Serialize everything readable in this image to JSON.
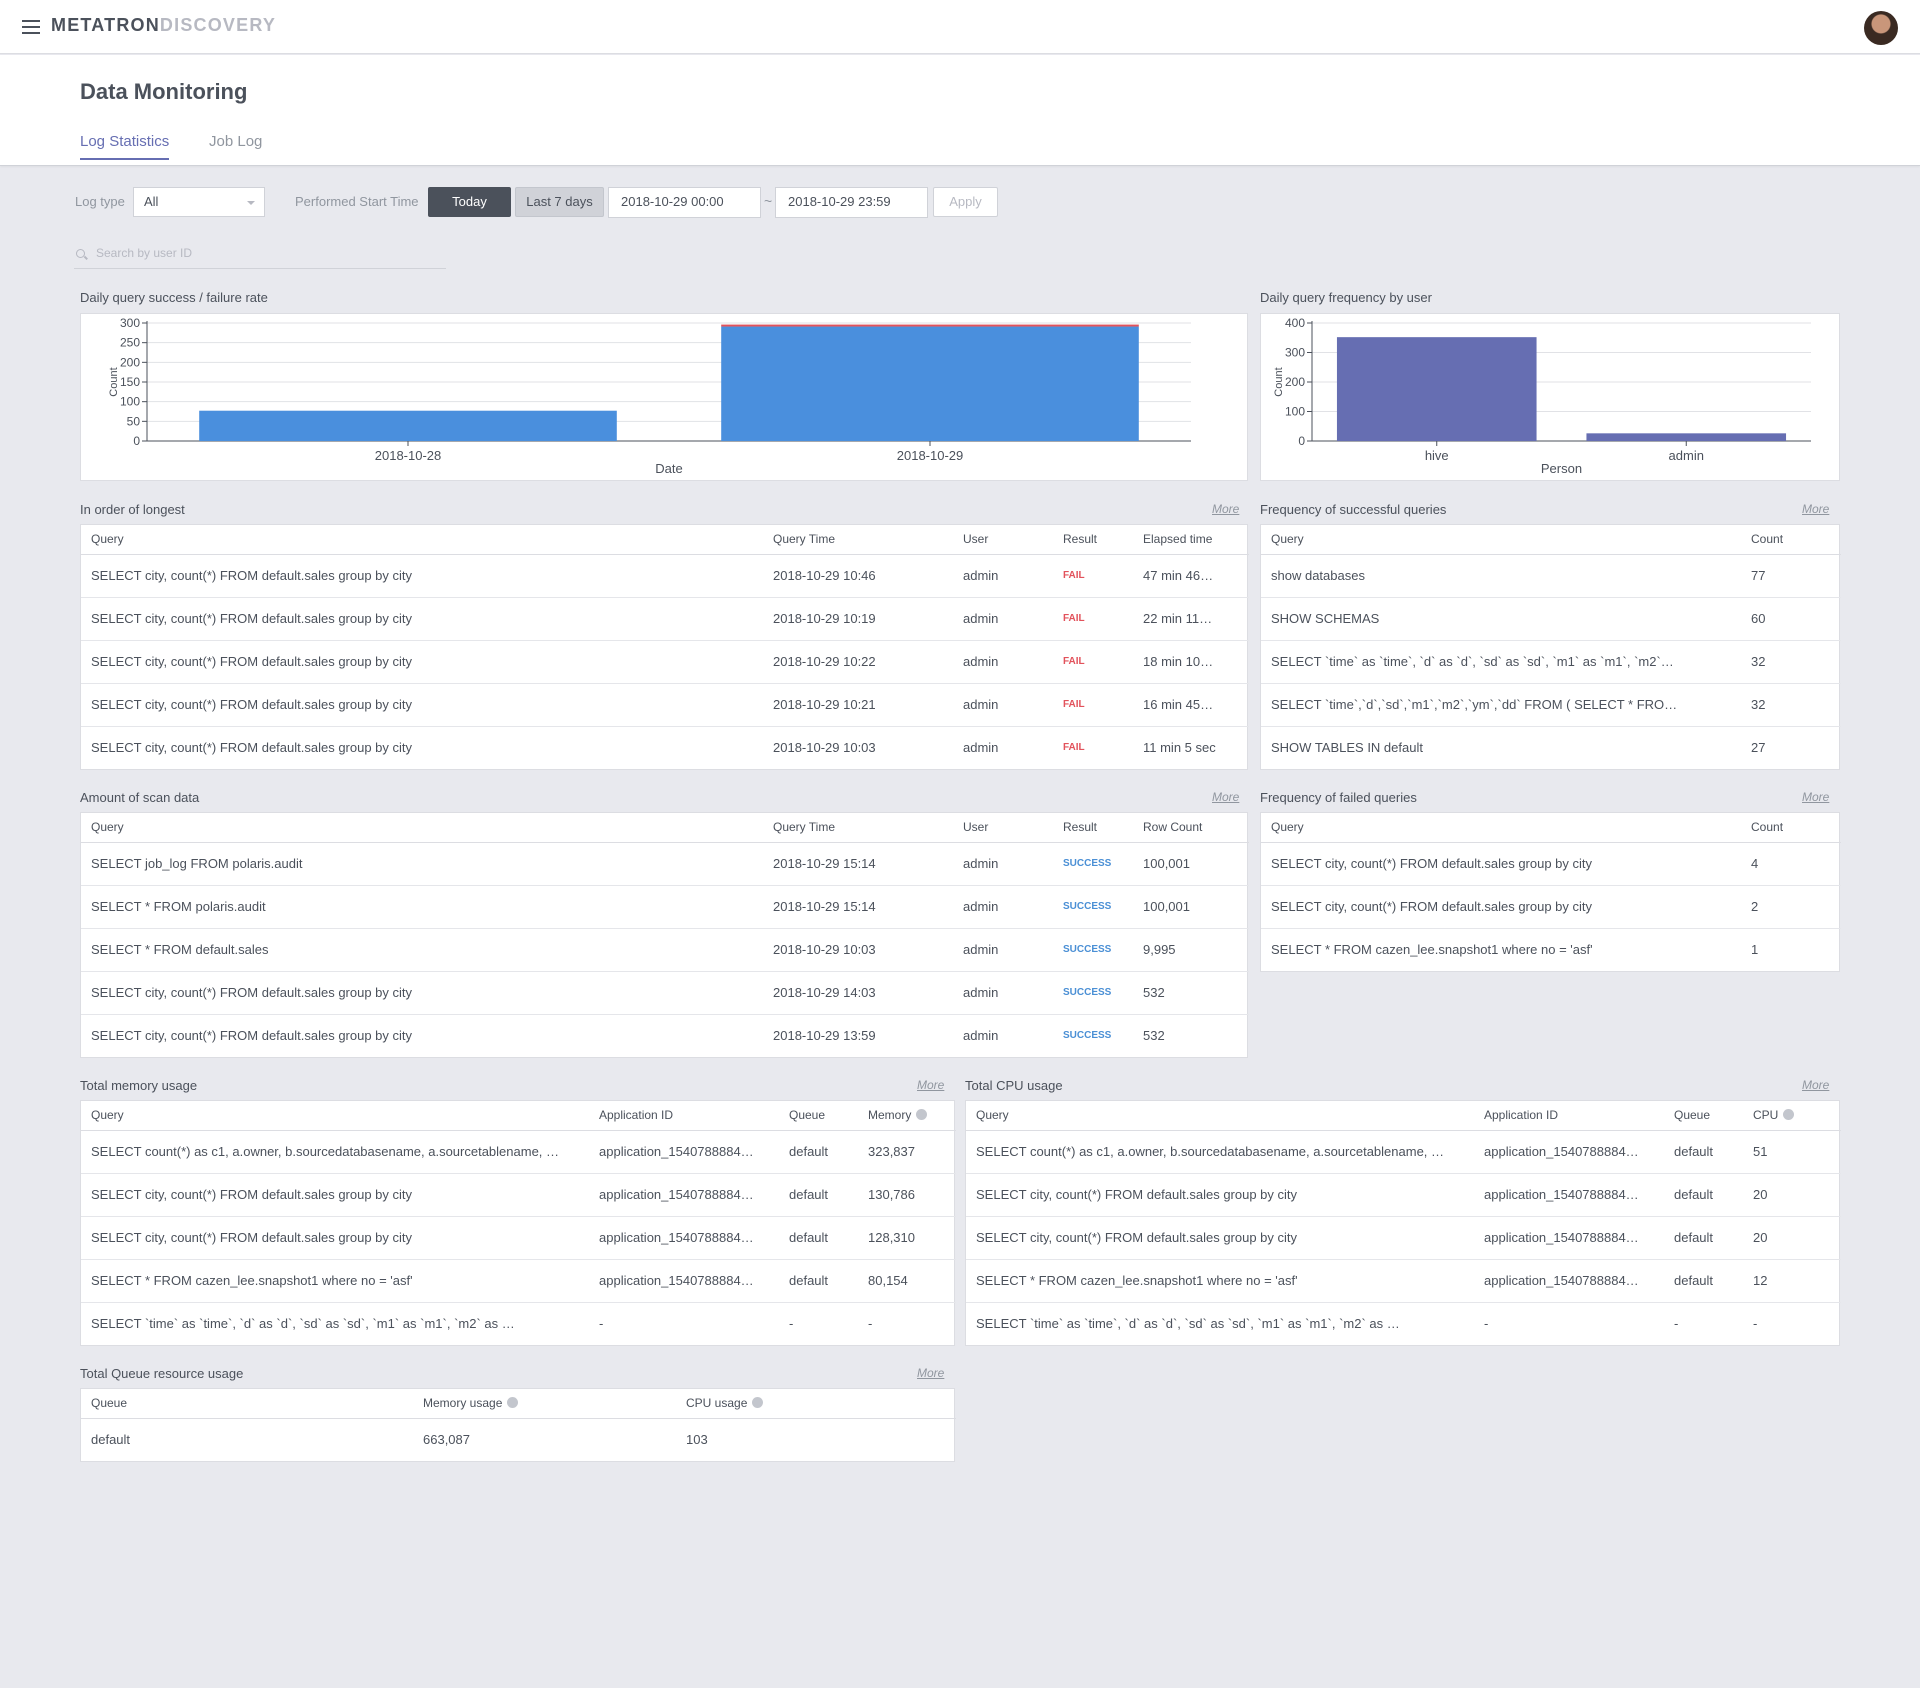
{
  "app": {
    "logo_part1": "METATRON",
    "logo_part2": "DISCOVERY"
  },
  "page": {
    "title": "Data Monitoring",
    "tabs": [
      {
        "label": "Log Statistics",
        "active": true
      },
      {
        "label": "Job Log",
        "active": false
      }
    ]
  },
  "filters": {
    "log_type_label": "Log type",
    "log_type_value": "All",
    "start_time_label": "Performed Start Time",
    "today_label": "Today",
    "last7_label": "Last 7 days",
    "date_from": "2018-10-29 00:00",
    "date_to": "2018-10-29 23:59",
    "tilde": "~",
    "apply_label": "Apply",
    "search_placeholder": "Search by user ID"
  },
  "more_label": "More",
  "daily_rate": {
    "title": "Daily query success / failure rate"
  },
  "daily_user": {
    "title": "Daily query frequency by user"
  },
  "chart_data": [
    {
      "type": "bar",
      "title": "Daily query success / failure rate",
      "stacked": true,
      "categories": [
        "2018-10-28",
        "2018-10-29"
      ],
      "series": [
        {
          "name": "",
          "color": "#4a8fdd",
          "values": [
            77,
            291
          ]
        },
        {
          "name": "",
          "color": "#e2525b",
          "values": [
            0,
            5
          ]
        }
      ],
      "xlabel": "Date",
      "ylabel": "Count",
      "ylim": [
        0,
        300
      ],
      "yticks": [
        0,
        50,
        100,
        150,
        200,
        250,
        300
      ],
      "grid": true
    },
    {
      "type": "bar",
      "title": "Daily query frequency by user",
      "categories": [
        "hive",
        "admin"
      ],
      "series": [
        {
          "name": "",
          "color": "#666eb2",
          "values": [
            352,
            26
          ]
        }
      ],
      "xlabel": "Person",
      "ylabel": "Count",
      "ylim": [
        0,
        400
      ],
      "yticks": [
        0,
        100,
        200,
        300,
        400
      ],
      "grid": true
    }
  ],
  "longest": {
    "title": "In order of longest",
    "headers": [
      "Query",
      "Query Time",
      "User",
      "Result",
      "Elapsed time"
    ],
    "rows": [
      [
        "SELECT city, count(*) FROM default.sales group by city",
        "2018-10-29 10:46",
        "admin",
        "FAIL",
        "47 min 46…"
      ],
      [
        "SELECT city, count(*) FROM default.sales group by city",
        "2018-10-29 10:19",
        "admin",
        "FAIL",
        "22 min 11…"
      ],
      [
        "SELECT city, count(*) FROM default.sales group by city",
        "2018-10-29 10:22",
        "admin",
        "FAIL",
        "18 min 10…"
      ],
      [
        "SELECT city, count(*) FROM default.sales group by city",
        "2018-10-29 10:21",
        "admin",
        "FAIL",
        "16 min 45…"
      ],
      [
        "SELECT city, count(*) FROM default.sales group by city",
        "2018-10-29 10:03",
        "admin",
        "FAIL",
        "11 min 5 sec"
      ]
    ]
  },
  "success_freq": {
    "title": "Frequency of successful queries",
    "headers": [
      "Query",
      "Count"
    ],
    "rows": [
      [
        "show databases",
        "77"
      ],
      [
        "SHOW SCHEMAS",
        "60"
      ],
      [
        "SELECT `time` as `time`, `d` as `d`, `sd` as `sd`, `m1` as `m1`, `m2`…",
        "32"
      ],
      [
        "SELECT `time`,`d`,`sd`,`m1`,`m2`,`ym`,`dd` FROM ( SELECT * FRO…",
        "32"
      ],
      [
        "SHOW TABLES IN default",
        "27"
      ]
    ]
  },
  "scan": {
    "title": "Amount of scan data",
    "headers": [
      "Query",
      "Query Time",
      "User",
      "Result",
      "Row Count"
    ],
    "rows": [
      [
        "SELECT job_log FROM polaris.audit",
        "2018-10-29 15:14",
        "admin",
        "SUCCESS",
        "100,001"
      ],
      [
        "SELECT * FROM polaris.audit",
        "2018-10-29 15:14",
        "admin",
        "SUCCESS",
        "100,001"
      ],
      [
        "SELECT * FROM default.sales",
        "2018-10-29 10:03",
        "admin",
        "SUCCESS",
        "9,995"
      ],
      [
        "SELECT city, count(*) FROM default.sales group by city",
        "2018-10-29 14:03",
        "admin",
        "SUCCESS",
        "532"
      ],
      [
        "SELECT city, count(*) FROM default.sales group by city",
        "2018-10-29 13:59",
        "admin",
        "SUCCESS",
        "532"
      ]
    ]
  },
  "fail_freq": {
    "title": "Frequency of failed queries",
    "headers": [
      "Query",
      "Count"
    ],
    "rows": [
      [
        "SELECT city, count(*) FROM default.sales group by city",
        "4"
      ],
      [
        "SELECT city, count(*) FROM default.sales group by city",
        "2"
      ],
      [
        "SELECT * FROM cazen_lee.snapshot1 where no = 'asf'",
        "1"
      ]
    ]
  },
  "memory": {
    "title": "Total memory usage",
    "headers": [
      "Query",
      "Application ID",
      "Queue",
      "Memory"
    ],
    "rows": [
      [
        "SELECT count(*) as c1, a.owner, b.sourcedatabasename, a.sourcetablename, …",
        "application_1540788884…",
        "default",
        "323,837"
      ],
      [
        "SELECT city, count(*) FROM default.sales group by city",
        "application_1540788884…",
        "default",
        "130,786"
      ],
      [
        "SELECT city, count(*) FROM default.sales group by city",
        "application_1540788884…",
        "default",
        "128,310"
      ],
      [
        "SELECT * FROM cazen_lee.snapshot1 where no = 'asf'",
        "application_1540788884…",
        "default",
        "80,154"
      ],
      [
        "SELECT `time` as `time`, `d` as `d`, `sd` as `sd`, `m1` as `m1`, `m2` as …",
        "-",
        "-",
        "-"
      ]
    ]
  },
  "cpu": {
    "title": "Total CPU usage",
    "headers": [
      "Query",
      "Application ID",
      "Queue",
      "CPU"
    ],
    "rows": [
      [
        "SELECT count(*) as c1, a.owner, b.sourcedatabasename, a.sourcetablename, …",
        "application_1540788884…",
        "default",
        "51"
      ],
      [
        "SELECT city, count(*) FROM default.sales group by city",
        "application_1540788884…",
        "default",
        "20"
      ],
      [
        "SELECT city, count(*) FROM default.sales group by city",
        "application_1540788884…",
        "default",
        "20"
      ],
      [
        "SELECT * FROM cazen_lee.snapshot1 where no = 'asf'",
        "application_1540788884…",
        "default",
        "12"
      ],
      [
        "SELECT `time` as `time`, `d` as `d`, `sd` as `sd`, `m1` as `m1`, `m2` as …",
        "-",
        "-",
        "-"
      ]
    ]
  },
  "queue": {
    "title": "Total Queue resource usage",
    "headers": [
      "Queue",
      "Memory usage",
      "CPU usage"
    ],
    "rows": [
      [
        "default",
        "663,087",
        "103"
      ]
    ]
  }
}
